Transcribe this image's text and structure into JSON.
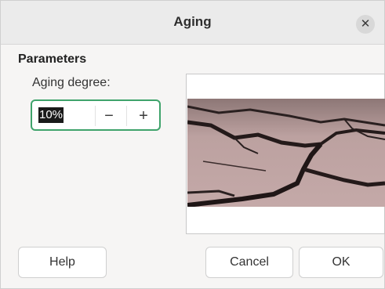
{
  "dialog": {
    "title": "Aging",
    "close_icon": "close-icon"
  },
  "parameters": {
    "section_title": "Parameters",
    "aging_degree_label": "Aging degree:",
    "aging_degree_value": "10%",
    "decrement_symbol": "−",
    "increment_symbol": "+"
  },
  "buttons": {
    "help": "Help",
    "cancel": "Cancel",
    "ok": "OK"
  },
  "colors": {
    "focus_border": "#3fa36b",
    "preview_tint": "#b89a98"
  }
}
